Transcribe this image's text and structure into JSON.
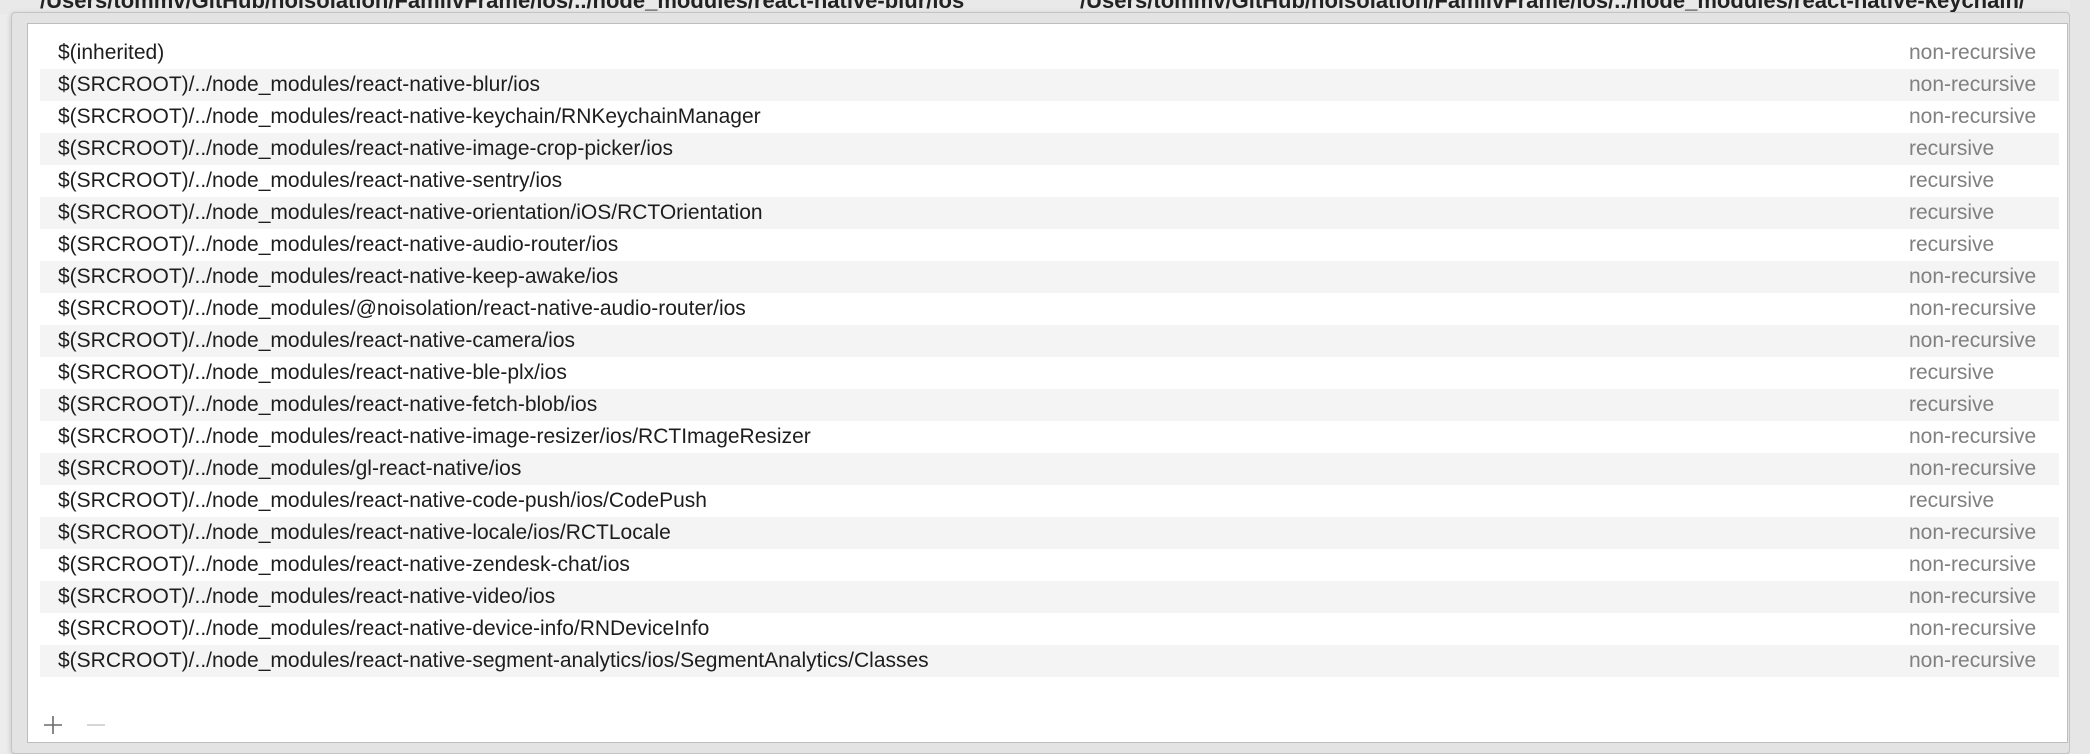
{
  "background_window": {
    "left_text": "/Users/tommv/GitHub/noisolation/FamilvFrame/ios/../node_modules/react-native-blur/ios",
    "right_text": "/Users/tommv/GitHub/noisolation/FamilvFrame/ios/../node_modules/react-native-keychain/"
  },
  "paths_table": {
    "rows": [
      {
        "path": "$(inherited)",
        "mode": "non-recursive"
      },
      {
        "path": "$(SRCROOT)/../node_modules/react-native-blur/ios",
        "mode": "non-recursive"
      },
      {
        "path": "$(SRCROOT)/../node_modules/react-native-keychain/RNKeychainManager",
        "mode": "non-recursive"
      },
      {
        "path": "$(SRCROOT)/../node_modules/react-native-image-crop-picker/ios",
        "mode": "recursive"
      },
      {
        "path": "$(SRCROOT)/../node_modules/react-native-sentry/ios",
        "mode": "recursive"
      },
      {
        "path": "$(SRCROOT)/../node_modules/react-native-orientation/iOS/RCTOrientation",
        "mode": "recursive"
      },
      {
        "path": "$(SRCROOT)/../node_modules/react-native-audio-router/ios",
        "mode": "recursive"
      },
      {
        "path": "$(SRCROOT)/../node_modules/react-native-keep-awake/ios",
        "mode": "non-recursive"
      },
      {
        "path": "$(SRCROOT)/../node_modules/@noisolation/react-native-audio-router/ios",
        "mode": "non-recursive"
      },
      {
        "path": "$(SRCROOT)/../node_modules/react-native-camera/ios",
        "mode": "non-recursive"
      },
      {
        "path": "$(SRCROOT)/../node_modules/react-native-ble-plx/ios",
        "mode": "recursive"
      },
      {
        "path": "$(SRCROOT)/../node_modules/react-native-fetch-blob/ios",
        "mode": "recursive"
      },
      {
        "path": "$(SRCROOT)/../node_modules/react-native-image-resizer/ios/RCTImageResizer",
        "mode": "non-recursive"
      },
      {
        "path": "$(SRCROOT)/../node_modules/gl-react-native/ios",
        "mode": "non-recursive"
      },
      {
        "path": "$(SRCROOT)/../node_modules/react-native-code-push/ios/CodePush",
        "mode": "recursive"
      },
      {
        "path": "$(SRCROOT)/../node_modules/react-native-locale/ios/RCTLocale",
        "mode": "non-recursive"
      },
      {
        "path": "$(SRCROOT)/../node_modules/react-native-zendesk-chat/ios",
        "mode": "non-recursive"
      },
      {
        "path": "$(SRCROOT)/../node_modules/react-native-video/ios",
        "mode": "non-recursive"
      },
      {
        "path": "$(SRCROOT)/../node_modules/react-native-device-info/RNDeviceInfo",
        "mode": "non-recursive"
      },
      {
        "path": "$(SRCROOT)/../node_modules/react-native-segment-analytics/ios/SegmentAnalytics/Classes",
        "mode": "non-recursive"
      }
    ]
  },
  "toolbar": {
    "add_icon": "plus-icon",
    "remove_icon": "minus-icon"
  },
  "colors": {
    "row_alt": "#f4f4f4",
    "mode_text": "#808080",
    "path_text": "#1d1d1d"
  }
}
